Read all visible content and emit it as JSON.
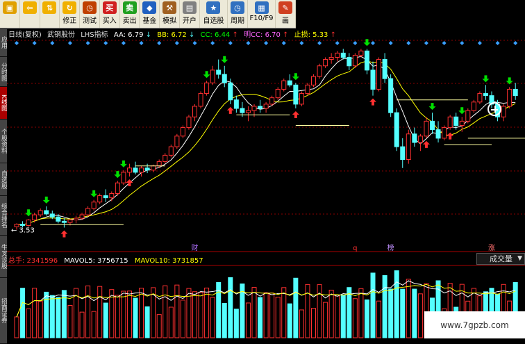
{
  "toolbar": {
    "items": [
      {
        "name": "app-logo",
        "label": "",
        "icon": "app-logo-icon",
        "color": "#e0a000",
        "glyph": "▣"
      },
      {
        "name": "back",
        "label": "",
        "icon": "back-arrow-icon",
        "color": "#f0b000",
        "glyph": "⇦"
      },
      {
        "name": "up-down",
        "label": "",
        "icon": "up-down-arrows-icon",
        "color": "#f0b000",
        "glyph": "⇅"
      },
      {
        "name": "fix",
        "label": "修正",
        "icon": "fix-icon",
        "color": "#f0b000",
        "glyph": "↻"
      },
      {
        "name": "test",
        "label": "测试",
        "icon": "clock-icon",
        "color": "#c04000",
        "glyph": "◷"
      },
      {
        "name": "buy",
        "label": "买入",
        "icon": "buy-icon",
        "color": "#d02020",
        "glyph": "买"
      },
      {
        "name": "sell",
        "label": "卖出",
        "icon": "sell-icon",
        "color": "#20a020",
        "glyph": "卖"
      },
      {
        "name": "fund",
        "label": "基金",
        "icon": "fund-icon",
        "color": "#2060c0",
        "glyph": "◆"
      },
      {
        "name": "simulate",
        "label": "模拟",
        "icon": "hammer-icon",
        "color": "#a06020",
        "glyph": "⚒"
      },
      {
        "name": "open-account",
        "label": "开户",
        "icon": "lock-icon",
        "color": "#808080",
        "glyph": "▤"
      },
      {
        "name": "favorites",
        "label": "自选股",
        "icon": "favorites-icon",
        "color": "#3070c0",
        "glyph": "★"
      },
      {
        "name": "period",
        "label": "周期",
        "icon": "period-icon",
        "color": "#3070c0",
        "glyph": "◷"
      },
      {
        "name": "f10",
        "label": "F10/F9",
        "icon": "f10-icon",
        "color": "#3070c0",
        "glyph": "▦"
      },
      {
        "name": "draw",
        "label": "画",
        "icon": "draw-icon",
        "color": "#d04020",
        "glyph": "✎"
      }
    ]
  },
  "sidebar": {
    "tabs": [
      {
        "name": "tab-app",
        "label": "应用",
        "active": false,
        "h": 41
      },
      {
        "name": "tab-timeshare",
        "label": "分时图",
        "active": false,
        "h": 42
      },
      {
        "name": "tab-kline",
        "label": "K线图",
        "active": true,
        "h": 46
      },
      {
        "name": "tab-stock-info",
        "label": "个股资料",
        "active": false,
        "h": 62
      },
      {
        "name": "tab-favorites",
        "label": "自选股",
        "active": false,
        "h": 46
      },
      {
        "name": "tab-general",
        "label": "综合排名",
        "active": false,
        "h": 56
      },
      {
        "name": "tab-sector",
        "label": "牛叉诊股",
        "active": false,
        "h": 60
      },
      {
        "name": "tab-more",
        "label": "招商证券",
        "active": false,
        "h": 94
      }
    ]
  },
  "infobar": {
    "title": "日线(复权)",
    "stock": "武钢股份",
    "indicator": "LHS指标",
    "aa": "AA: 6.79",
    "bb": "BB: 6.72",
    "cc": "CC: 6.44",
    "mcc": "明CC: 6.70",
    "stop": "止损: 5.33"
  },
  "price_marks": {
    "low_label": "3.53"
  },
  "markers": {
    "cai": "财",
    "q": "q",
    "bang": "榜",
    "zhang": "涨"
  },
  "volbar": {
    "total": "总手: 2341596",
    "mavol5": "MAVOL5: 3756715",
    "mavol10": "MAVOL10: 3731857",
    "dropdown": "成交量"
  },
  "watermark": "www.7gpzb.com",
  "colors": {
    "up": "#ff3030",
    "down": "#54ffff",
    "ma1": "#ffffff",
    "ma2": "#ffff00",
    "buy_arrow": "#00e000",
    "sell_arrow": "#ff3030",
    "grid": "#8b0000",
    "aa": "#ffffff",
    "bb": "#ffff00",
    "cc": "#00ff00",
    "mcc": "#ff00ff",
    "stop": "#ffff00",
    "total": "#ff3030",
    "mavol5": "#ffffff",
    "mavol10": "#ffff00"
  },
  "chart_data": {
    "type": "candlestick",
    "candles": [
      [
        3.62,
        3.7,
        3.55,
        3.68
      ],
      [
        3.68,
        3.75,
        3.6,
        3.65
      ],
      [
        3.65,
        3.8,
        3.62,
        3.78
      ],
      [
        3.78,
        3.95,
        3.72,
        3.9
      ],
      [
        3.9,
        4.05,
        3.85,
        4.0
      ],
      [
        4.0,
        4.1,
        3.88,
        3.92
      ],
      [
        3.92,
        4.0,
        3.8,
        3.85
      ],
      [
        3.85,
        3.92,
        3.7,
        3.75
      ],
      [
        3.75,
        3.82,
        3.6,
        3.72
      ],
      [
        3.72,
        3.8,
        3.65,
        3.78
      ],
      [
        3.78,
        3.88,
        3.7,
        3.82
      ],
      [
        3.82,
        3.95,
        3.78,
        3.9
      ],
      [
        3.9,
        4.1,
        3.86,
        4.05
      ],
      [
        4.05,
        4.25,
        4.0,
        4.2
      ],
      [
        4.2,
        4.4,
        4.15,
        4.35
      ],
      [
        4.35,
        4.5,
        4.2,
        4.3
      ],
      [
        4.3,
        4.45,
        4.22,
        4.4
      ],
      [
        4.4,
        4.7,
        4.35,
        4.65
      ],
      [
        4.65,
        4.95,
        4.6,
        4.9
      ],
      [
        4.9,
        5.1,
        4.8,
        5.0
      ],
      [
        5.0,
        5.15,
        4.85,
        4.9
      ],
      [
        4.9,
        5.05,
        4.8,
        5.0
      ],
      [
        5.0,
        5.1,
        4.88,
        4.95
      ],
      [
        4.95,
        5.08,
        4.9,
        5.05
      ],
      [
        5.05,
        5.2,
        5.0,
        5.15
      ],
      [
        5.15,
        5.35,
        5.1,
        5.3
      ],
      [
        5.3,
        5.55,
        5.25,
        5.5
      ],
      [
        5.5,
        5.8,
        5.45,
        5.75
      ],
      [
        5.75,
        6.0,
        5.7,
        5.95
      ],
      [
        5.95,
        6.25,
        5.9,
        6.2
      ],
      [
        6.2,
        6.5,
        6.1,
        6.45
      ],
      [
        6.45,
        6.8,
        6.4,
        6.75
      ],
      [
        6.75,
        7.05,
        6.7,
        7.0
      ],
      [
        7.0,
        7.4,
        6.95,
        7.3
      ],
      [
        7.3,
        7.55,
        7.1,
        7.2
      ],
      [
        7.2,
        7.4,
        6.9,
        7.0
      ],
      [
        7.0,
        7.1,
        6.5,
        6.6
      ],
      [
        6.6,
        6.7,
        6.3,
        6.4
      ],
      [
        6.4,
        6.55,
        6.2,
        6.3
      ],
      [
        6.3,
        6.45,
        6.1,
        6.35
      ],
      [
        6.35,
        6.5,
        6.2,
        6.45
      ],
      [
        6.45,
        6.6,
        6.3,
        6.4
      ],
      [
        6.4,
        6.55,
        6.3,
        6.5
      ],
      [
        6.5,
        6.7,
        6.45,
        6.65
      ],
      [
        6.65,
        6.9,
        6.6,
        6.85
      ],
      [
        6.85,
        7.1,
        6.8,
        7.05
      ],
      [
        7.05,
        7.2,
        6.9,
        6.95
      ],
      [
        6.95,
        7.0,
        6.4,
        6.5
      ],
      [
        6.5,
        6.8,
        6.45,
        6.75
      ],
      [
        6.75,
        7.0,
        6.7,
        6.95
      ],
      [
        6.95,
        7.2,
        6.9,
        7.15
      ],
      [
        7.15,
        7.45,
        7.1,
        7.4
      ],
      [
        7.4,
        7.6,
        7.35,
        7.55
      ],
      [
        7.55,
        7.7,
        7.45,
        7.6
      ],
      [
        7.6,
        7.75,
        7.5,
        7.7
      ],
      [
        7.7,
        7.8,
        7.55,
        7.6
      ],
      [
        7.6,
        7.7,
        7.3,
        7.4
      ],
      [
        7.4,
        7.7,
        7.35,
        7.65
      ],
      [
        7.65,
        7.8,
        7.6,
        7.75
      ],
      [
        7.75,
        7.8,
        7.2,
        7.3
      ],
      [
        7.3,
        7.5,
        6.7,
        6.85
      ],
      [
        6.85,
        7.6,
        6.8,
        7.55
      ],
      [
        7.55,
        7.7,
        7.0,
        7.1
      ],
      [
        7.1,
        7.2,
        6.2,
        6.3
      ],
      [
        6.3,
        6.4,
        5.4,
        5.5
      ],
      [
        5.5,
        5.7,
        5.0,
        5.2
      ],
      [
        5.2,
        5.9,
        5.1,
        5.8
      ],
      [
        5.8,
        5.95,
        5.5,
        5.6
      ],
      [
        5.6,
        5.8,
        5.4,
        5.75
      ],
      [
        5.75,
        6.2,
        5.7,
        6.1
      ],
      [
        6.1,
        6.3,
        5.8,
        5.9
      ],
      [
        5.9,
        6.1,
        5.6,
        5.7
      ],
      [
        5.7,
        6.0,
        5.65,
        5.95
      ],
      [
        5.95,
        6.25,
        5.9,
        6.2
      ],
      [
        6.2,
        6.3,
        5.9,
        6.0
      ],
      [
        6.0,
        6.2,
        5.85,
        6.1
      ],
      [
        6.1,
        6.4,
        6.05,
        6.35
      ],
      [
        6.35,
        6.6,
        6.3,
        6.55
      ],
      [
        6.55,
        6.8,
        6.5,
        6.75
      ],
      [
        6.75,
        6.95,
        6.6,
        6.7
      ],
      [
        6.7,
        6.8,
        6.4,
        6.5
      ],
      [
        6.5,
        6.6,
        6.1,
        6.2
      ],
      [
        6.2,
        6.5,
        6.1,
        6.45
      ],
      [
        6.45,
        6.9,
        6.4,
        6.85
      ],
      [
        6.85,
        7.0,
        6.6,
        6.7
      ]
    ],
    "volume_ylim": [
      0,
      6000000
    ]
  }
}
